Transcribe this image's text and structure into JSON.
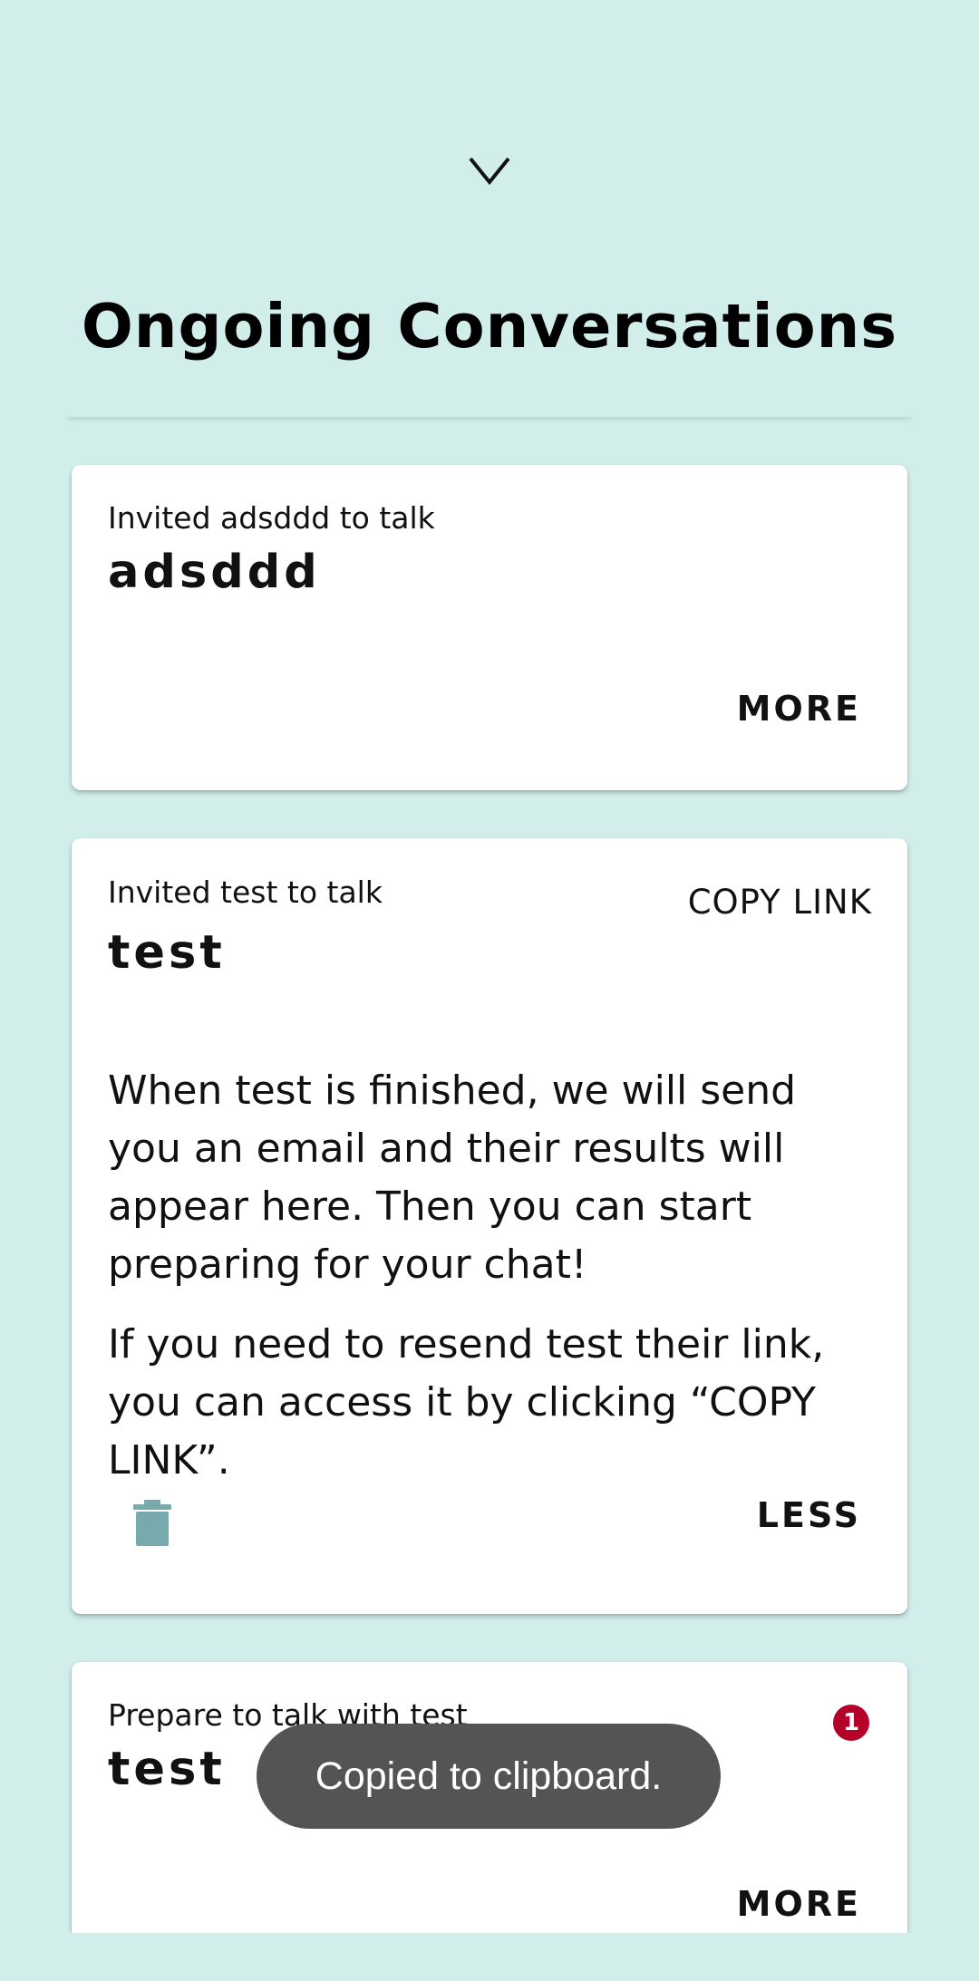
{
  "header": {
    "collapse_icon": "chevron-down-icon",
    "title": "Ongoing Conversations"
  },
  "cards": [
    {
      "subtitle": "Invited adsddd to talk",
      "name": "adsddd",
      "action_label": "MORE"
    },
    {
      "subtitle": "Invited test to talk",
      "name": "test",
      "copy_link_label": "COPY LINK",
      "body": [
        "When test is finished, we will send you an email and their results will appear here. Then you can start preparing for your chat!",
        "If you need to resend test their link, you can access it by clicking “COPY LINK”."
      ],
      "delete_icon": "trash-icon",
      "action_label": "LESS"
    },
    {
      "subtitle": "Prepare to talk with test",
      "name": "test",
      "badge_count": "1",
      "action_label": "MORE"
    }
  ],
  "toast": {
    "message": "Copied to clipboard."
  },
  "colors": {
    "background": "#d1eeeb",
    "card": "#ffffff",
    "icon_accent": "#78a9ad",
    "badge": "#b5002a",
    "toast": "#545454"
  }
}
